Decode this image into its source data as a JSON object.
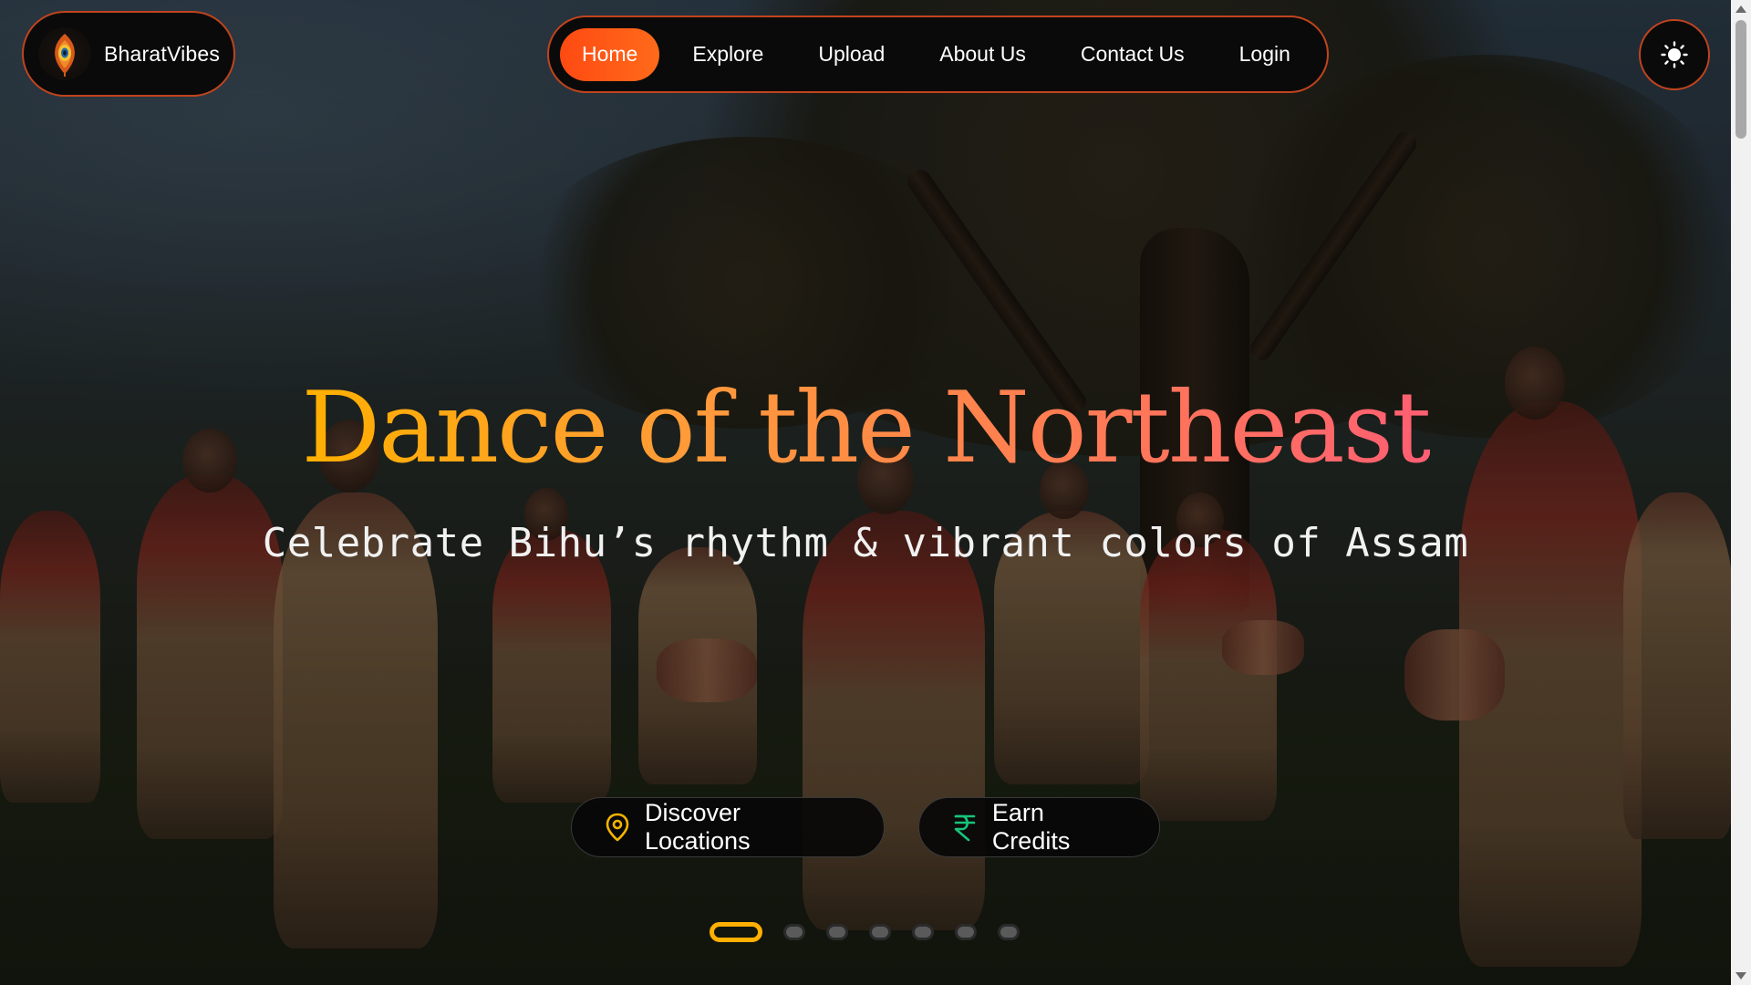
{
  "brand": {
    "name": "BharatVibes",
    "logo_icon": "peacock-feather-icon"
  },
  "nav": {
    "items": [
      {
        "label": "Home",
        "active": true
      },
      {
        "label": "Explore",
        "active": false
      },
      {
        "label": "Upload",
        "active": false
      },
      {
        "label": "About Us",
        "active": false
      },
      {
        "label": "Contact Us",
        "active": false
      },
      {
        "label": "Login",
        "active": false
      }
    ]
  },
  "theme_toggle": {
    "icon": "sun-icon"
  },
  "hero": {
    "title": "Dance of the Northeast",
    "subtitle": "Celebrate Bihu’s rhythm & vibrant colors of Assam",
    "buttons": [
      {
        "label": "Discover Locations",
        "icon": "map-pin-icon"
      },
      {
        "label": "Earn Credits",
        "icon": "rupee-icon"
      }
    ],
    "slides": {
      "total": 7,
      "active_index": 0
    }
  },
  "colors": {
    "accent": "#ff4a12",
    "border_accent": "#c0441e",
    "title_gradient": [
      "#ffb000",
      "#ff9a3a",
      "#ff7a55",
      "#ff5f73"
    ],
    "pin_icon": "#f5b400",
    "rupee_icon": "#16c47a",
    "active_dot": "#ffb000"
  }
}
